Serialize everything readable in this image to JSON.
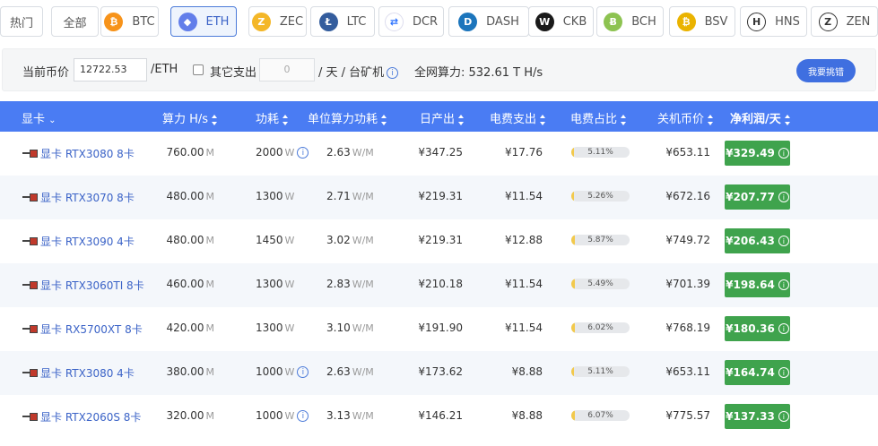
{
  "tabs": [
    {
      "label": "热门",
      "icon": "",
      "active": false
    },
    {
      "label": "全部",
      "icon": "",
      "active": false
    },
    {
      "label": "BTC",
      "icon": "btc",
      "active": false
    },
    {
      "label": "ETH",
      "icon": "eth",
      "active": true
    },
    {
      "label": "ZEC",
      "icon": "zec",
      "active": false
    },
    {
      "label": "LTC",
      "icon": "ltc",
      "active": false
    },
    {
      "label": "DCR",
      "icon": "dcr",
      "active": false
    },
    {
      "label": "DASH",
      "icon": "dash",
      "active": false
    },
    {
      "label": "CKB",
      "icon": "ckb",
      "active": false
    },
    {
      "label": "BCH",
      "icon": "bch",
      "active": false
    },
    {
      "label": "BSV",
      "icon": "bsv",
      "active": false
    },
    {
      "label": "HNS",
      "icon": "hns",
      "active": false
    },
    {
      "label": "ZEN",
      "icon": "zen",
      "active": false
    }
  ],
  "settings": {
    "price_label": "当前币价",
    "price_value": "12722.53",
    "price_unit": "/ETH",
    "other_expense_label": "其它支出",
    "other_expense_placeholder": "0",
    "other_expense_unit": "/ 天 / 台矿机",
    "network_hashrate": "全网算力: 532.61 T H/s",
    "pick_button": "我要挑错"
  },
  "table": {
    "headers": {
      "gpu": "显卡",
      "hashrate": "算力 H/s",
      "power": "功耗",
      "efficiency": "单位算力功耗",
      "daily_output": "日产出",
      "electricity": "电费支出",
      "elec_ratio": "电费占比",
      "shutdown_price": "关机币价",
      "net_profit": "净利润/天"
    },
    "units": {
      "hash": "M",
      "watt": "W",
      "eff": "W/M"
    },
    "rows": [
      {
        "name": "显卡 RTX3080 8卡",
        "hashrate": "760.00",
        "power": "2000",
        "power_info": true,
        "efficiency": "2.63",
        "output": "¥347.25",
        "electricity": "¥17.76",
        "ratio_label": "5.11%",
        "ratio": 0.0511,
        "shutdown": "¥653.11",
        "profit": "¥329.49"
      },
      {
        "name": "显卡 RTX3070 8卡",
        "hashrate": "480.00",
        "power": "1300",
        "power_info": false,
        "efficiency": "2.71",
        "output": "¥219.31",
        "electricity": "¥11.54",
        "ratio_label": "5.26%",
        "ratio": 0.0526,
        "shutdown": "¥672.16",
        "profit": "¥207.77"
      },
      {
        "name": "显卡 RTX3090 4卡",
        "hashrate": "480.00",
        "power": "1450",
        "power_info": false,
        "efficiency": "3.02",
        "output": "¥219.31",
        "electricity": "¥12.88",
        "ratio_label": "5.87%",
        "ratio": 0.0587,
        "shutdown": "¥749.72",
        "profit": "¥206.43"
      },
      {
        "name": "显卡 RTX3060TI 8卡",
        "hashrate": "460.00",
        "power": "1300",
        "power_info": false,
        "efficiency": "2.83",
        "output": "¥210.18",
        "electricity": "¥11.54",
        "ratio_label": "5.49%",
        "ratio": 0.0549,
        "shutdown": "¥701.39",
        "profit": "¥198.64"
      },
      {
        "name": "显卡 RX5700XT 8卡",
        "hashrate": "420.00",
        "power": "1300",
        "power_info": false,
        "efficiency": "3.10",
        "output": "¥191.90",
        "electricity": "¥11.54",
        "ratio_label": "6.02%",
        "ratio": 0.0602,
        "shutdown": "¥768.19",
        "profit": "¥180.36"
      },
      {
        "name": "显卡 RTX3080 4卡",
        "hashrate": "380.00",
        "power": "1000",
        "power_info": true,
        "efficiency": "2.63",
        "output": "¥173.62",
        "electricity": "¥8.88",
        "ratio_label": "5.11%",
        "ratio": 0.0511,
        "shutdown": "¥653.11",
        "profit": "¥164.74"
      },
      {
        "name": "显卡 RTX2060S 8卡",
        "hashrate": "320.00",
        "power": "1000",
        "power_info": true,
        "efficiency": "3.13",
        "output": "¥146.21",
        "electricity": "¥8.88",
        "ratio_label": "6.07%",
        "ratio": 0.0607,
        "shutdown": "¥775.57",
        "profit": "¥137.33"
      }
    ]
  },
  "colors": {
    "accent": "#4a7cf3",
    "profit": "#3fa34d",
    "link": "#3b63c7"
  }
}
